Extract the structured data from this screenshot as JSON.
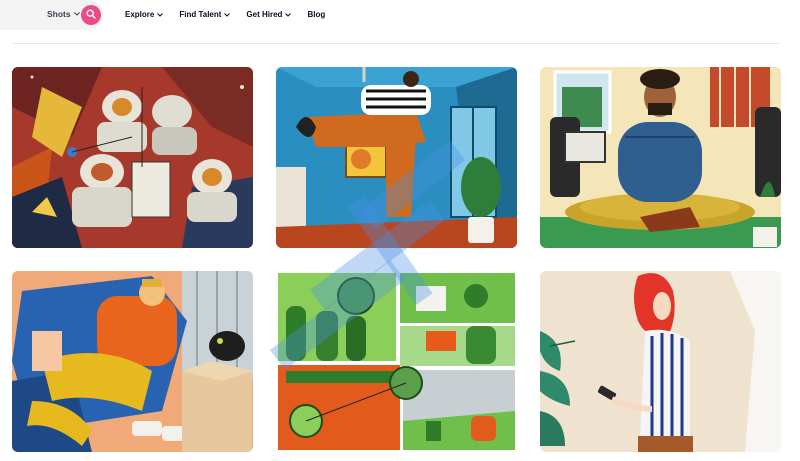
{
  "header": {
    "shots_label": "Shots",
    "nav": [
      {
        "label": "Explore"
      },
      {
        "label": "Find Talent"
      },
      {
        "label": "Get Hired"
      },
      {
        "label": "Blog"
      }
    ]
  },
  "colors": {
    "accent": "#ea4c89",
    "nav_text": "#0d0c22",
    "search_bg": "#f3f3f4"
  },
  "icons": {
    "search": "search-icon",
    "chevron": "chevron-down-icon"
  }
}
